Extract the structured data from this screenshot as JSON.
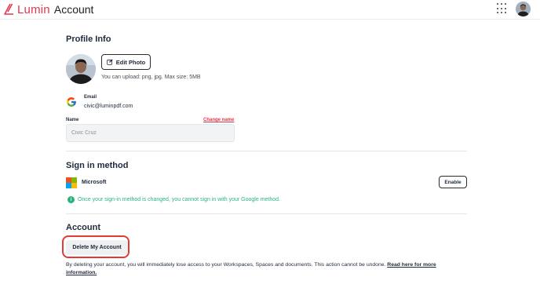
{
  "header": {
    "brand": "Lumin",
    "subtitle": "Account",
    "brand_color": "#e1374a",
    "apps_icon": "grid-dots-icon",
    "avatar": "user-avatar"
  },
  "profile": {
    "title": "Profile Info",
    "edit_photo_label": "Edit Photo",
    "upload_hint": "You can upload: png, jpg. Max size: 5MB",
    "email_label": "Email",
    "email_value": "civic@luminpdf.com",
    "name_label": "Name",
    "change_name_label": "Change name",
    "name_value": "Civic Cruz"
  },
  "sign_in": {
    "title": "Sign in method",
    "provider": "Microsoft",
    "enable_label": "Enable",
    "notice": "Once your sign-in method is changed, you cannot sign in with your Google method.",
    "notice_color": "#2bb37d"
  },
  "account": {
    "title": "Account",
    "delete_label": "Delete My Account",
    "warning_text": "By deleting your account, you will immediately lose access to your Workspaces, Spaces and documents. This action cannot be undone.",
    "read_more": "Read here for more information.",
    "highlight_color": "#e23b35"
  }
}
